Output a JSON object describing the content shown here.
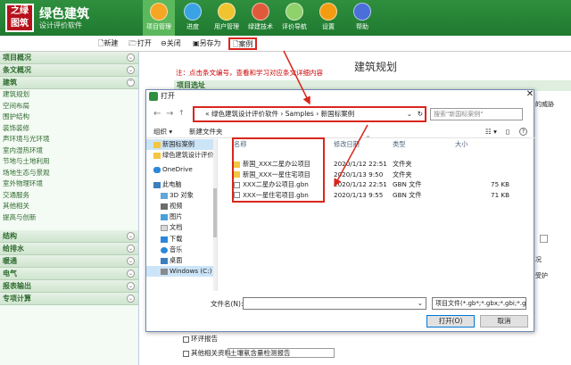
{
  "app": {
    "logo_chars": [
      "之",
      "绿",
      "图",
      "筑"
    ],
    "title": "绿色建筑",
    "subtitle": "设计评价软件"
  },
  "nav": [
    {
      "label": "项目管理",
      "icon": "folder-icon",
      "color": "#f6a623"
    },
    {
      "label": "进度",
      "icon": "refresh-icon",
      "color": "#3aa3e3"
    },
    {
      "label": "用户管理",
      "icon": "users-icon",
      "color": "#f0c330"
    },
    {
      "label": "绿建技术",
      "icon": "tools-icon",
      "color": "#e05a3a"
    },
    {
      "label": "评价导航",
      "icon": "document-icon",
      "color": "#8fd16a"
    },
    {
      "label": "设置",
      "icon": "gear-icon",
      "color": "#f39c12"
    },
    {
      "label": "帮助",
      "icon": "help-icon",
      "color": "#4a6fd8"
    }
  ],
  "toolbar": {
    "new_label": "新建",
    "open_label": "打开",
    "close_label": "关闭",
    "saveas_label": "另存为",
    "case_label": "案例"
  },
  "sidebar": {
    "sections_top": [
      "项目概况",
      "条文概况"
    ],
    "building_section": "建筑",
    "building_items": [
      "建筑规划",
      "空间布局",
      "围护结构",
      "装饰装修",
      "声环境与光环境",
      "室内湿热环境",
      "节地与土地利用",
      "场地生态与景观",
      "室外物理环境",
      "交通服务",
      "其他相关",
      "提高与创新"
    ],
    "sections_bottom": [
      "结构",
      "给排水",
      "暖通",
      "电气",
      "报表输出",
      "专项计算"
    ]
  },
  "main": {
    "title": "建筑规划",
    "note": "注：点击条文编号，查看和学习对应条文详细内容",
    "bar_label": "项目选址",
    "check1": "环评报告",
    "check2": "其他相关资料",
    "text_value": "土壤氡含量检测报告",
    "side_hint_1": "的威胁",
    "side_hint_2": "况",
    "side_hint_3": "受护"
  },
  "dialog": {
    "title": "打开",
    "close_glyph": "✕",
    "path": [
      "«",
      "绿色建筑设计评价软件",
      "›",
      "Samples",
      "›",
      "新国标案例"
    ],
    "search_placeholder": "搜索\"新国标案例\"",
    "organize": "组织 ▾",
    "new_folder": "新建文件夹",
    "tree": [
      {
        "label": "新国标案例",
        "icon": "folder",
        "selected": true
      },
      {
        "label": "绿色建筑设计评价 (3",
        "icon": "folder",
        "selected": false
      },
      {
        "label": "OneDrive",
        "icon": "cloud",
        "selected": false
      },
      {
        "label": "此电脑",
        "icon": "pc",
        "selected": false
      },
      {
        "label": "3D 对象",
        "icon": "cube",
        "selected": false
      },
      {
        "label": "视频",
        "icon": "video",
        "selected": false
      },
      {
        "label": "图片",
        "icon": "picture",
        "selected": false
      },
      {
        "label": "文档",
        "icon": "doc",
        "selected": false
      },
      {
        "label": "下载",
        "icon": "download",
        "selected": false
      },
      {
        "label": "音乐",
        "icon": "music",
        "selected": false
      },
      {
        "label": "桌面",
        "icon": "desktop",
        "selected": false
      },
      {
        "label": "Windows (C:)",
        "icon": "drive",
        "selected": true
      }
    ],
    "columns": [
      "名称",
      "修改日期",
      "类型",
      "大小"
    ],
    "files": [
      {
        "name": "新国_XXX二星办公项目",
        "date": "2020/1/12 22:51",
        "type": "文件夹",
        "size": "",
        "kind": "folder"
      },
      {
        "name": "新国_XXX一星住宅项目",
        "date": "2020/1/13 9:50",
        "type": "文件夹",
        "size": "",
        "kind": "folder"
      },
      {
        "name": "XXX二星办公项目.gbn",
        "date": "2020/1/12 22:51",
        "type": "GBN 文件",
        "size": "75 KB",
        "kind": "file"
      },
      {
        "name": "XXX一星住宅项目.gbn",
        "date": "2020/1/13 9:55",
        "type": "GBN 文件",
        "size": "71 KB",
        "kind": "file"
      }
    ],
    "filename_label": "文件名(N):",
    "filetype_value": "项目文件(*.gb*;*.gbx;*.gbi;*.gb",
    "open_button": "打开(O)",
    "cancel_button": "取消"
  },
  "colors": {
    "header_green": "#1f7a30",
    "highlight_red": "#d9261c",
    "selection_blue": "#cce4f7"
  }
}
